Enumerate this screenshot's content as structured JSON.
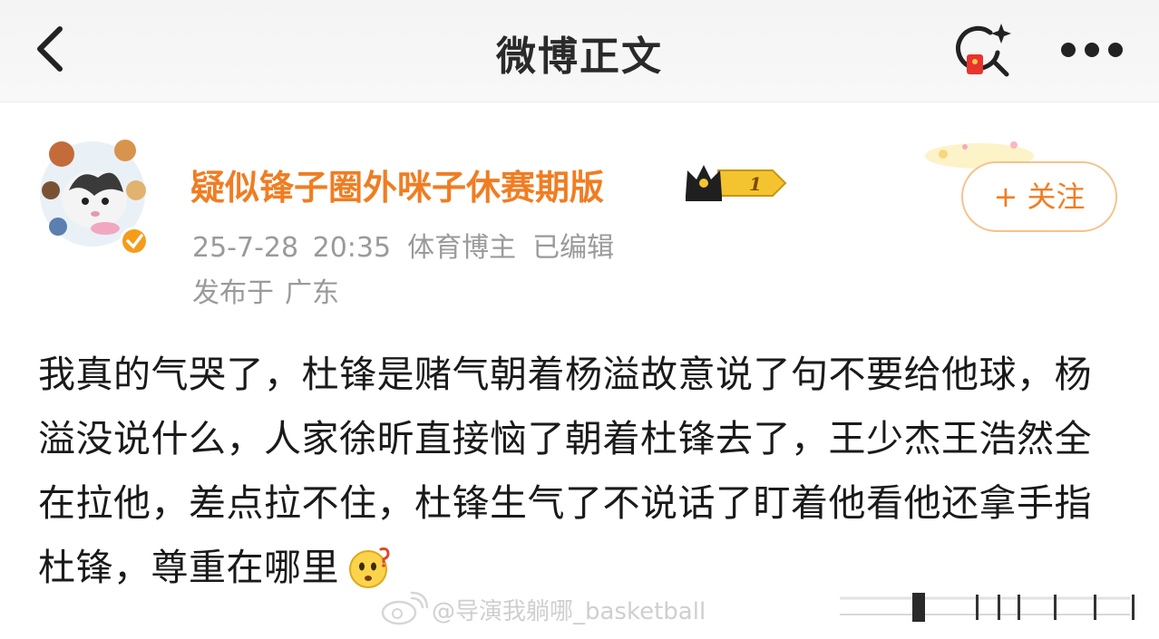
{
  "nav": {
    "title": "微博正文"
  },
  "post": {
    "author_name": "疑似锋子圈外咪子休赛期版",
    "badge_level": "1",
    "timestamp": "25-7-28 20:35",
    "author_role": "体育博主",
    "edited_label": "已编辑",
    "location_prefix": "发布于",
    "location": "广东",
    "follow_label": "+ 关注",
    "text": "我真的气哭了，杜锋是赌气朝着杨溢故意说了句不要给他球，杨溢没说什么，人家徐昕直接恼了朝着杜锋去了，王少杰王浩然全在拉他，差点拉不住，杜锋生气了不说话了盯着他看他还拿手指杜锋，尊重在哪里"
  },
  "watermark": {
    "text": "@导演我躺哪_basketball"
  },
  "colors": {
    "accent_orange": "#f07d22",
    "meta_gray": "#9a9a9a",
    "follow_border": "#f6c28b"
  },
  "icons": [
    "back-arrow-icon",
    "search-redpacket-icon",
    "more-dots-icon",
    "crown-badge-icon",
    "verified-badge-icon",
    "confused-emoji-icon",
    "weibo-logo-icon"
  ]
}
